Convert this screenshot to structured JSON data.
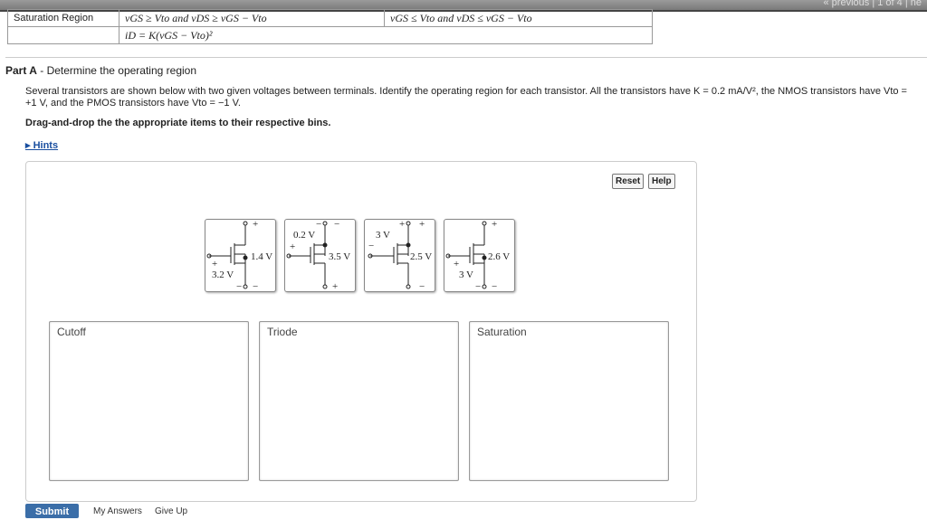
{
  "pager": {
    "previous": "« previous",
    "sep": "|",
    "position": "1 of 4",
    "next": "| ne"
  },
  "table": {
    "row_label": "Saturation Region",
    "nmos_condition": "vGS ≥ Vto and vDS ≥ vGS − Vto",
    "pmos_condition": "vGS ≤ Vto and vDS ≤ vGS − Vto",
    "current": "iD = K(vGS − Vto)²"
  },
  "part": {
    "label": "Part A",
    "title": " - Determine the operating region"
  },
  "instructions": "Several transistors are shown below with two given voltages between terminals. Identify the operating region for each transistor. All the transistors have K = 0.2 mA/V², the NMOS transistors have Vto = +1 V, and the PMOS transistors have Vto = −1 V.",
  "drag_drop": "Drag-and-drop the the appropriate items to their respective bins.",
  "hints": "▸ Hints",
  "buttons": {
    "reset": "Reset",
    "help": "Help",
    "submit": "Submit",
    "my_answers": "My Answers",
    "give_up": "Give Up"
  },
  "items": [
    {
      "v1": "3.2 V",
      "v2": "1.4 V"
    },
    {
      "v1": "0.2 V",
      "v2": "3.5 V"
    },
    {
      "v1": "3 V",
      "v2": "2.5 V"
    },
    {
      "v1": "3 V",
      "v2": "2.6 V"
    }
  ],
  "bins": [
    "Cutoff",
    "Triode",
    "Saturation"
  ]
}
